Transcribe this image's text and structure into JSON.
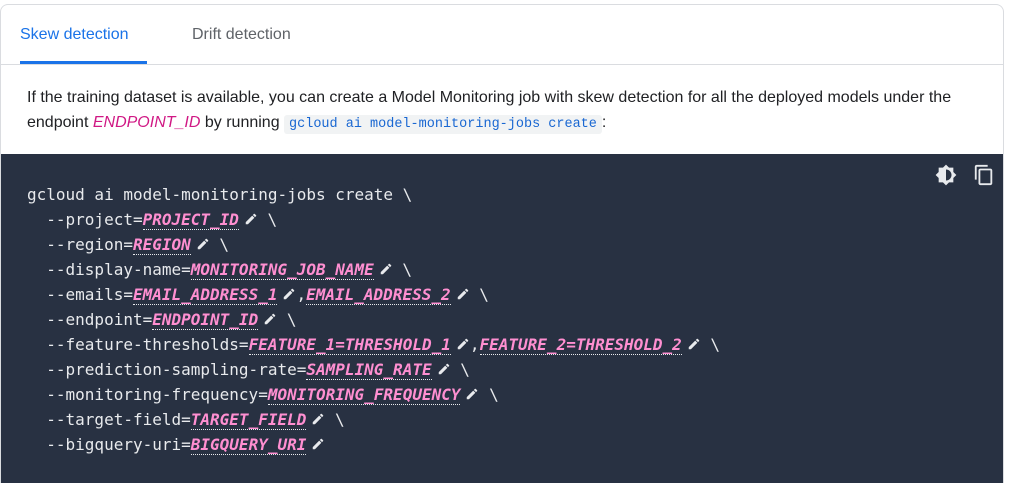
{
  "tabs": [
    {
      "label": "Skew detection",
      "active": true
    },
    {
      "label": "Drift detection",
      "active": false
    }
  ],
  "description": {
    "part1": "If the training dataset is available, you can create a Model Monitoring job with skew detection for all the deployed models under the endpoint ",
    "endpoint_var": "ENDPOINT_ID",
    "part2": " by running ",
    "command": "gcloud ai model-monitoring-jobs create",
    "part3": ":"
  },
  "code_toolbar": {
    "icons": [
      "dark-theme-icon",
      "copy-icon"
    ]
  },
  "code": {
    "command": "gcloud ai model-monitoring-jobs create \\",
    "lines": [
      {
        "flag": "  --project=",
        "placeholders": [
          "PROJECT_ID"
        ],
        "suffix": " \\"
      },
      {
        "flag": "  --region=",
        "placeholders": [
          "REGION"
        ],
        "suffix": " \\"
      },
      {
        "flag": "  --display-name=",
        "placeholders": [
          "MONITORING_JOB_NAME"
        ],
        "suffix": " \\"
      },
      {
        "flag": "  --emails=",
        "placeholders": [
          "EMAIL_ADDRESS_1",
          "EMAIL_ADDRESS_2"
        ],
        "suffix": " \\"
      },
      {
        "flag": "  --endpoint=",
        "placeholders": [
          "ENDPOINT_ID"
        ],
        "suffix": " \\"
      },
      {
        "flag": "  --feature-thresholds=",
        "placeholders": [
          "FEATURE_1=THRESHOLD_1",
          "FEATURE_2=THRESHOLD_2"
        ],
        "suffix": " \\"
      },
      {
        "flag": "  --prediction-sampling-rate=",
        "placeholders": [
          "SAMPLING_RATE"
        ],
        "suffix": " \\"
      },
      {
        "flag": "  --monitoring-frequency=",
        "placeholders": [
          "MONITORING_FREQUENCY"
        ],
        "suffix": " \\"
      },
      {
        "flag": "  --target-field=",
        "placeholders": [
          "TARGET_FIELD"
        ],
        "suffix": " \\"
      },
      {
        "flag": "  --bigquery-uri=",
        "placeholders": [
          "BIGQUERY_URI"
        ],
        "suffix": ""
      }
    ],
    "separator": ","
  },
  "colors": {
    "accent": "#1a73e8",
    "variable": "#d01884",
    "placeholder": "#ff8fd1",
    "code_bg": "#283142"
  }
}
